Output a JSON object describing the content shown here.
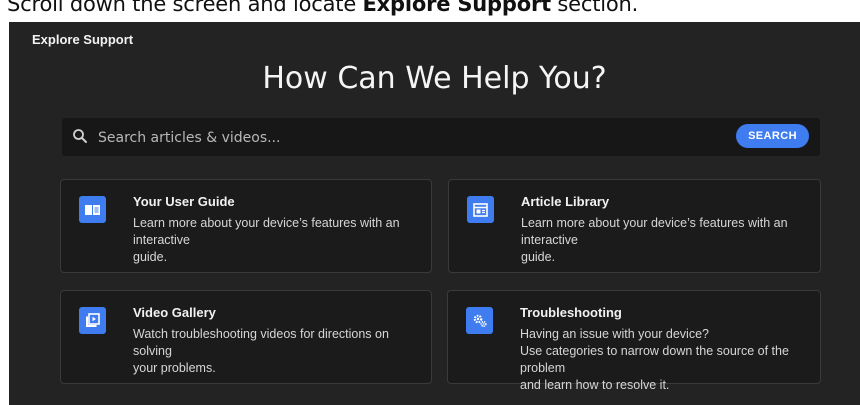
{
  "instruction": {
    "prefix": "Scroll down the screen and locate ",
    "emphasis": "Explore Support",
    "suffix": " section."
  },
  "section": {
    "label": "Explore Support",
    "headline": "How Can We Help You?"
  },
  "search": {
    "placeholder": "Search articles & videos...",
    "button_label": "SEARCH"
  },
  "cards": [
    {
      "title": "Your User Guide",
      "lines": [
        "Learn more about your device’s features with an interactive",
        "guide."
      ],
      "icon": "book-icon"
    },
    {
      "title": "Article Library",
      "lines": [
        "Learn more about your device’s features with an interactive",
        "guide."
      ],
      "icon": "article-icon"
    },
    {
      "title": "Video Gallery",
      "lines": [
        "Watch troubleshooting videos for directions on solving",
        "your problems."
      ],
      "icon": "video-play-icon"
    },
    {
      "title": "Troubleshooting",
      "lines": [
        "Having an issue with your device?",
        "Use categories to narrow down the source of the problem",
        "and learn how to resolve it."
      ],
      "icon": "gears-icon"
    }
  ],
  "colors": {
    "accent": "#3f7cf0",
    "panel_bg": "#232323",
    "card_bg": "#1b1b1b"
  }
}
